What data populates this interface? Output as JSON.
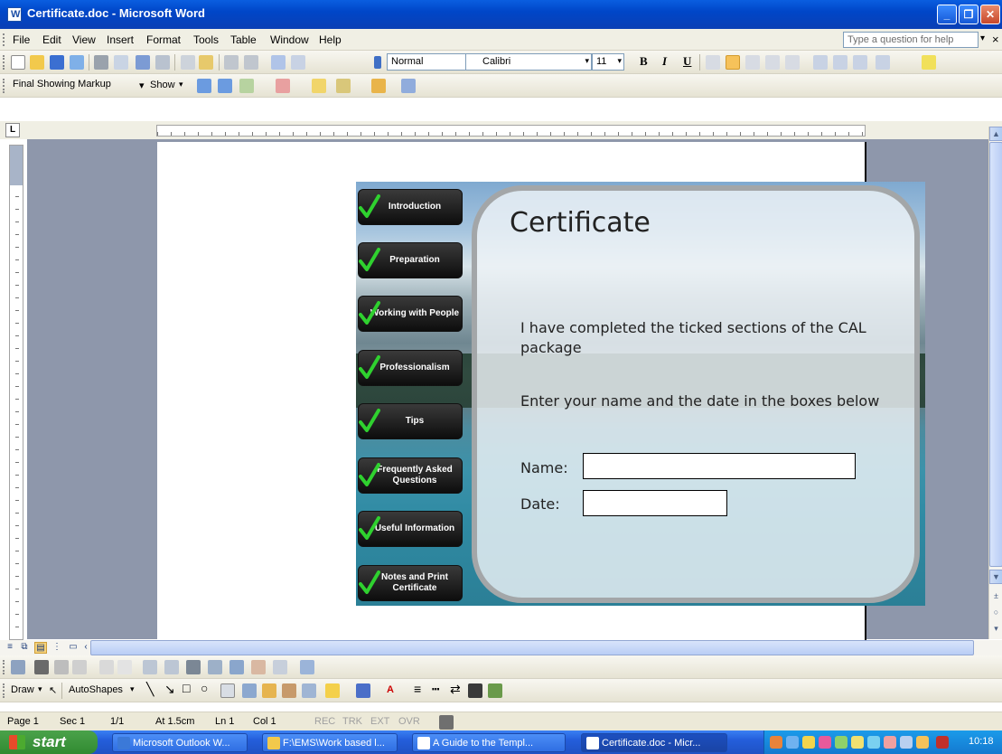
{
  "window": {
    "title": "Certificate.doc - Microsoft Word"
  },
  "menu": {
    "items": [
      "File",
      "Edit",
      "View",
      "Insert",
      "Format",
      "Tools",
      "Table",
      "Window",
      "Help"
    ],
    "help_placeholder": "Type a question for help"
  },
  "formatting": {
    "style": "Normal",
    "font": "Calibri",
    "size": "11",
    "bold": "B",
    "italic": "I",
    "underline": "U"
  },
  "reviewing": {
    "display_mode": "Final Showing Markup",
    "show_label": "Show"
  },
  "drawing": {
    "draw_label": "Draw",
    "autoshapes_label": "AutoShapes"
  },
  "certificate": {
    "title": "Certificate",
    "line1": "I have completed the ticked sections of the CAL package",
    "line2": "Enter your name and the date in the boxes below",
    "name_label": "Name:",
    "date_label": "Date:"
  },
  "sections": [
    "Introduction",
    "Preparation",
    "Working with People",
    "Professionalism",
    "Tips",
    "Frequently Asked Questions",
    "Useful Information",
    "Notes and Print Certificate"
  ],
  "status": {
    "page": "Page 1",
    "sec": "Sec 1",
    "pages": "1/1",
    "at": "At 1.5cm",
    "ln": "Ln 1",
    "col": "Col 1",
    "rec": "REC",
    "trk": "TRK",
    "ext": "EXT",
    "ovr": "OVR"
  },
  "taskbar": {
    "start": "start",
    "tasks": [
      "Microsoft Outlook W...",
      "F:\\EMS\\Work based l...",
      "A Guide to the Templ...",
      "Certificate.doc - Micr..."
    ],
    "clock": "10:18"
  },
  "colors": {
    "titlebar": "#0a5ee0",
    "check": "#2fd12f",
    "taskbar": "#245edb",
    "start": "#3c9a3c"
  }
}
